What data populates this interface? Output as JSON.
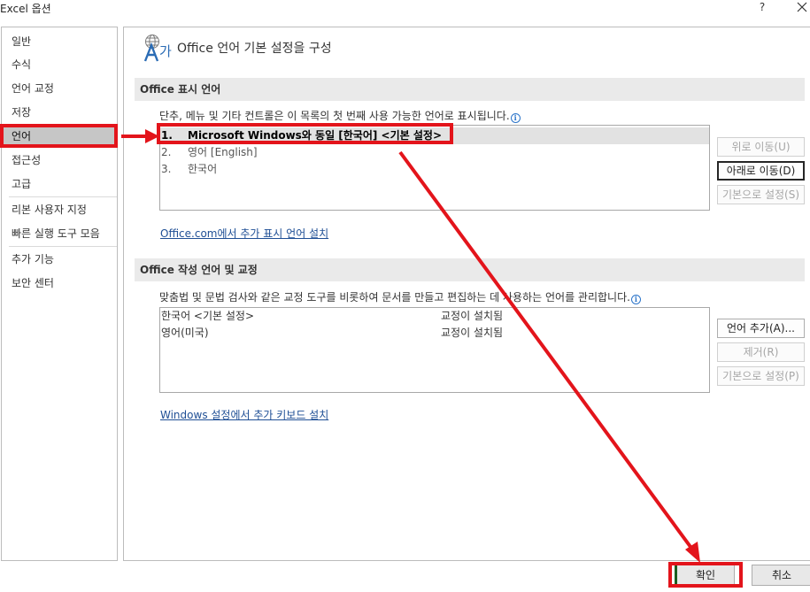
{
  "window": {
    "title": "Excel 옵션",
    "help_label": "?",
    "close_icon": "close-icon"
  },
  "sidebar": {
    "items": [
      {
        "label": "일반"
      },
      {
        "label": "수식"
      },
      {
        "label": "언어 교정"
      },
      {
        "label": "저장"
      },
      {
        "label": "언어",
        "selected": true
      },
      {
        "label": "접근성"
      },
      {
        "label": "고급"
      },
      {
        "label": "리본 사용자 지정"
      },
      {
        "label": "빠른 실행 도구 모음"
      },
      {
        "label": "추가 기능"
      },
      {
        "label": "보안 센터"
      }
    ]
  },
  "header": {
    "icon": "language-icon",
    "title": "Office 언어 기본 설정을 구성"
  },
  "display_section": {
    "heading": "Office 표시 언어",
    "description": "단추, 메뉴 및 기타 컨트롤은 이 목록의 첫 번째 사용 가능한 언어로 표시됩니다.",
    "languages": [
      {
        "num": "1.",
        "name": "Microsoft Windows와 동일 [한국어] <기본 설정>",
        "selected": true
      },
      {
        "num": "2.",
        "name": "영어 [English]"
      },
      {
        "num": "3.",
        "name": "한국어"
      }
    ],
    "buttons": {
      "move_up": "위로 이동(U)",
      "move_down": "아래로 이동(D)",
      "set_default": "기본으로 설정(S)"
    },
    "link": "Office.com에서 추가 표시 언어 설치"
  },
  "authoring_section": {
    "heading": "Office 작성 언어 및 교정",
    "description": "맞춤법 및 문법 검사와 같은 교정 도구를 비롯하여 문서를 만들고 편집하는 데 사용하는 언어를 관리합니다.",
    "languages": [
      {
        "name": "한국어 <기본 설정>",
        "status": "교정이 설치됨"
      },
      {
        "name": "영어(미국)",
        "status": "교정이 설치됨"
      }
    ],
    "buttons": {
      "add_language": "언어 추가(A)...",
      "remove": "제거(R)",
      "set_default": "기본으로 설정(P)"
    },
    "link": "Windows 설정에서 추가 키보드 설치"
  },
  "footer": {
    "ok": "확인",
    "cancel": "취소"
  },
  "colors": {
    "annotation": "#e3141b",
    "selected_bg": "#c6c6c6",
    "link": "#1f4f95"
  }
}
